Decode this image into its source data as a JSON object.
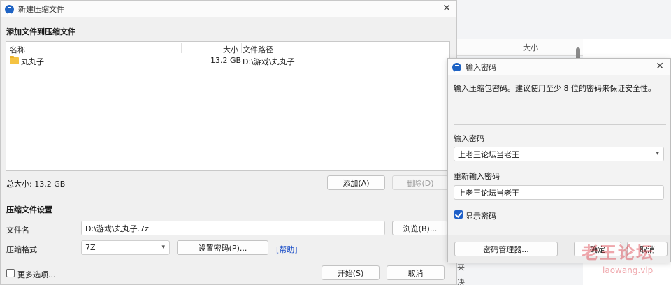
{
  "background_window": {
    "col_size": "大小",
    "row_1": "夹",
    "row_2": "决"
  },
  "main_dialog": {
    "title": "新建压缩文件",
    "add_section_label": "添加文件到压缩文件",
    "list_headers": {
      "name": "名称",
      "size": "大小",
      "path": "文件路径"
    },
    "files": [
      {
        "name": "丸丸子",
        "size": "13.2 GB",
        "path": "D:\\游戏\\丸丸子",
        "icon": "folder-icon"
      }
    ],
    "total_size": "总大小: 13.2 GB",
    "add_button": "添加(A)",
    "delete_button": "删除(D)",
    "settings_label": "压缩文件设置",
    "filename_label": "文件名",
    "filename_value": "D:\\游戏\\丸丸子.7z",
    "browse_button": "浏览(B)...",
    "format_label": "压缩格式",
    "format_value": "7Z",
    "set_password_button": "设置密码(P)...",
    "help_link": "[帮助]",
    "more_options_label": "更多选项...",
    "start_button": "开始(S)",
    "cancel_button": "取消"
  },
  "password_dialog": {
    "title": "输入密码",
    "intro": "输入压缩包密码。建议使用至少 8 位的密码来保证安全性。",
    "password_label": "输入密码",
    "password_value": "上老王论坛当老王",
    "reenter_label": "重新输入密码",
    "reenter_value": "上老王论坛当老王",
    "show_password_label": "显示密码",
    "show_password_checked": true,
    "manager_button": "密码管理器...",
    "ok_button": "确定",
    "cancel_button": "取消"
  },
  "watermark": {
    "cn": "老王论坛",
    "en": "laowang.vip"
  },
  "colors": {
    "accent": "#1e5fc8",
    "link": "#1c4fc7",
    "folder": "#f5c342",
    "watermark": "#dc3c46"
  }
}
